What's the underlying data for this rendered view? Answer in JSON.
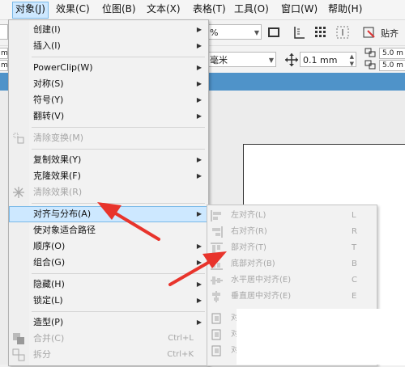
{
  "menubar": {
    "items": [
      {
        "label": "对象(J)"
      },
      {
        "label": "效果(C)"
      },
      {
        "label": "位图(B)"
      },
      {
        "label": "文本(X)"
      },
      {
        "label": "表格(T)"
      },
      {
        "label": "工具(O)"
      },
      {
        "label": "窗口(W)"
      },
      {
        "label": "帮助(H)"
      }
    ]
  },
  "toolbar": {
    "zoom_value": "%",
    "paste_label": "贴齐",
    "unit_label": "毫米",
    "nudge_value": "0.1 mm",
    "dup_x": "5.0 m",
    "dup_y": "5.0 m",
    "left_field_top": "m",
    "left_field_bottom": "m"
  },
  "object_menu": {
    "items": [
      {
        "label": "创建(I)",
        "submenu": true,
        "disabled": false
      },
      {
        "label": "插入(I)",
        "submenu": true,
        "disabled": false
      },
      {
        "label": "PowerClip(W)",
        "submenu": true,
        "disabled": false
      },
      {
        "label": "对称(S)",
        "submenu": true,
        "disabled": false
      },
      {
        "label": "符号(Y)",
        "submenu": true,
        "disabled": false
      },
      {
        "label": "翻转(V)",
        "submenu": true,
        "disabled": false
      },
      {
        "label": "清除变换(M)",
        "submenu": false,
        "disabled": true
      },
      {
        "label": "复制效果(Y)",
        "submenu": true,
        "disabled": false
      },
      {
        "label": "克隆效果(F)",
        "submenu": true,
        "disabled": false
      },
      {
        "label": "清除效果(R)",
        "submenu": false,
        "disabled": true
      },
      {
        "label": "对齐与分布(A)",
        "submenu": true,
        "disabled": false,
        "highlighted": true
      },
      {
        "label": "使对象适合路径",
        "submenu": false,
        "disabled": false
      },
      {
        "label": "顺序(O)",
        "submenu": true,
        "disabled": false
      },
      {
        "label": "组合(G)",
        "submenu": true,
        "disabled": false
      },
      {
        "label": "隐藏(H)",
        "submenu": true,
        "disabled": false
      },
      {
        "label": "锁定(L)",
        "submenu": true,
        "disabled": false
      },
      {
        "label": "造型(P)",
        "submenu": true,
        "disabled": false
      },
      {
        "label": "合并(C)",
        "shortcut": "Ctrl+L",
        "disabled": true
      },
      {
        "label": "拆分",
        "shortcut": "Ctrl+K",
        "disabled": true
      }
    ]
  },
  "align_submenu": {
    "items": [
      {
        "label": "左对齐(L)",
        "shortcut": "L"
      },
      {
        "label": "右对齐(R)",
        "shortcut": "R"
      },
      {
        "label": "部对齐(T)",
        "shortcut": "T"
      },
      {
        "label": "底部对齐(B)",
        "shortcut": "B"
      },
      {
        "label": "水平居中对齐(E)",
        "shortcut": "C"
      },
      {
        "label": "垂直居中对齐(E)",
        "shortcut": "E"
      },
      {
        "label": "对"
      },
      {
        "label": "对"
      },
      {
        "label": "对"
      }
    ]
  },
  "colors": {
    "highlight": "#cde8ff",
    "highlight_border": "#7ab9e8",
    "arrow": "#e8342c",
    "doc_tab": "#4f93c9"
  }
}
